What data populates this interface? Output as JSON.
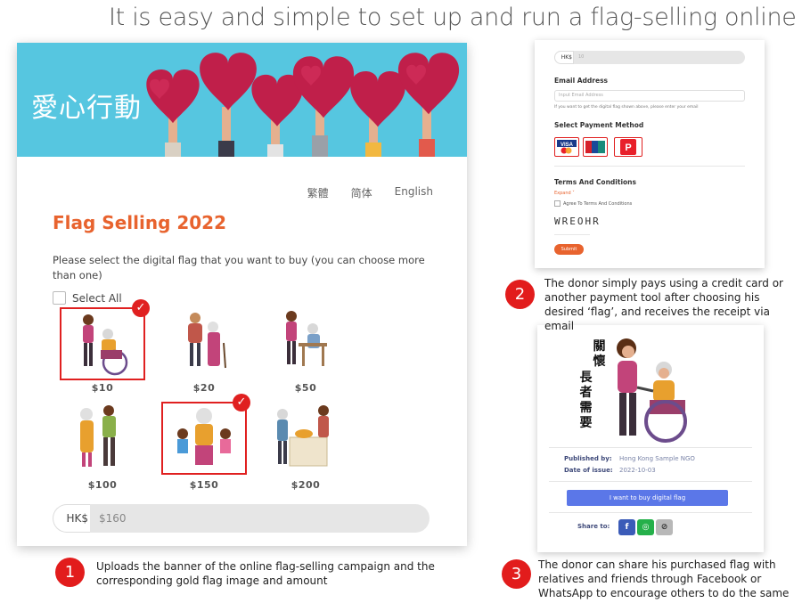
{
  "headline": "It is easy and simple to set up and run a flag-selling online",
  "campaign": {
    "banner_title": "愛心行動",
    "languages": [
      "繁體",
      "简体",
      "English"
    ],
    "title": "Flag Selling 2022",
    "instruction": "Please select the digital flag that you want to buy (you can choose more than one)",
    "select_all": "Select All",
    "flags": [
      {
        "price": "$10",
        "selected": true
      },
      {
        "price": "$20",
        "selected": false
      },
      {
        "price": "$50",
        "selected": false
      },
      {
        "price": "$100",
        "selected": false
      },
      {
        "price": "$150",
        "selected": true
      },
      {
        "price": "$200",
        "selected": false
      }
    ],
    "currency": "HK$",
    "amount": "$160"
  },
  "payment": {
    "currency": "HK$",
    "amount": "10",
    "email_label": "Email Address",
    "email_placeholder": "Input Email Address",
    "email_hint": "If you want to get the digital flag shown above, please enter your email",
    "method_label": "Select Payment Method",
    "methods": [
      "VISA",
      "UnionPay",
      "PayMe"
    ],
    "terms_label": "Terms And Conditions",
    "expand": "Expand",
    "agree": "Agree To Terms And Conditions",
    "captcha": "WREOHR",
    "submit": "Submit"
  },
  "share_card": {
    "flag_text_col1": "關懷",
    "flag_text_col2": "長者需要",
    "published_by_label": "Published by:",
    "published_by": "Hong Kong Sample NGO",
    "date_label": "Date of issue:",
    "date": "2022-10-03",
    "buy_button": "I want to buy digital flag",
    "share_label": "Share to:",
    "share_icons": [
      "facebook-icon",
      "whatsapp-icon",
      "link-icon"
    ]
  },
  "steps": [
    {
      "number": "1",
      "text": "Uploads the banner of the online flag-selling campaign and the corresponding gold flag image and amount"
    },
    {
      "number": "2",
      "text": "The donor simply pays using a credit card or another payment tool after choosing his desired ‘flag’, and receives the receipt via email"
    },
    {
      "number": "3",
      "text": "The donor can share his purchased flag with relatives and friends through Facebook or WhatsApp to encourage others to do the same"
    }
  ],
  "colors": {
    "accent": "#e8632e",
    "banner": "#56c6e0",
    "step_circle": "#e21c1c",
    "button": "#5b77e8"
  }
}
